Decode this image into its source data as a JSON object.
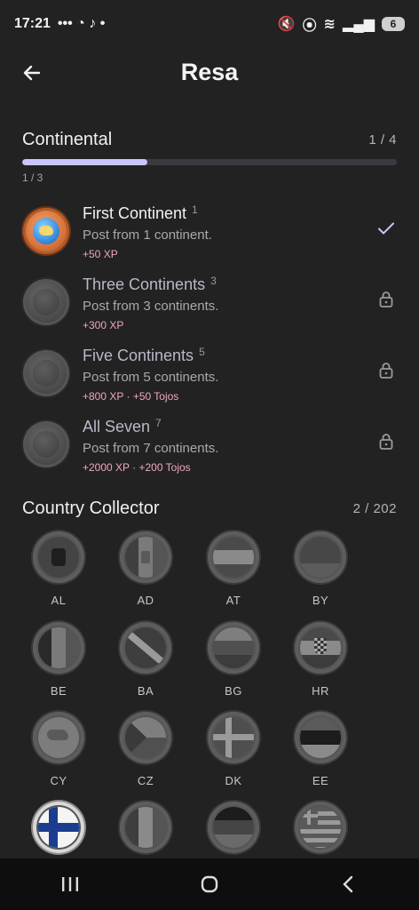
{
  "status_bar": {
    "time": "17:21",
    "battery": "6"
  },
  "app_bar": {
    "title": "Resa"
  },
  "continental": {
    "title": "Continental",
    "count": "1 / 4",
    "progress_label": "1 / 3",
    "progress_fraction": 0.333,
    "achievements": [
      {
        "name": "First Continent",
        "level": "1",
        "desc": "Post from 1 continent.",
        "reward": "+50 XP",
        "status": "completed",
        "status_icon": "check-icon"
      },
      {
        "name": "Three Continents",
        "level": "3",
        "desc": "Post from 3 continents.",
        "reward": "+300 XP",
        "status": "locked",
        "status_icon": "lock-icon"
      },
      {
        "name": "Five Continents",
        "level": "5",
        "desc": "Post from 5 continents.",
        "reward": "+800 XP · +50 Tojos",
        "status": "locked",
        "status_icon": "lock-icon"
      },
      {
        "name": "All Seven",
        "level": "7",
        "desc": "Post from 7 continents.",
        "reward": "+2000 XP · +200 Tojos",
        "status": "locked",
        "status_icon": "lock-icon"
      }
    ]
  },
  "country_collector": {
    "title": "Country Collector",
    "count": "2 / 202",
    "countries": [
      {
        "code": "AL",
        "unlocked": false
      },
      {
        "code": "AD",
        "unlocked": false
      },
      {
        "code": "AT",
        "unlocked": false
      },
      {
        "code": "BY",
        "unlocked": false
      },
      {
        "code": "BE",
        "unlocked": false
      },
      {
        "code": "BA",
        "unlocked": false
      },
      {
        "code": "BG",
        "unlocked": false
      },
      {
        "code": "HR",
        "unlocked": false
      },
      {
        "code": "CY",
        "unlocked": false
      },
      {
        "code": "CZ",
        "unlocked": false
      },
      {
        "code": "DK",
        "unlocked": false
      },
      {
        "code": "EE",
        "unlocked": false
      },
      {
        "code": "FI",
        "unlocked": true
      },
      {
        "code": "FR",
        "unlocked": false
      },
      {
        "code": "DE",
        "unlocked": false
      },
      {
        "code": "GR",
        "unlocked": false
      }
    ]
  },
  "colors": {
    "accent": "#c9c5ff",
    "reward": "#f0a7bd",
    "background": "#222222"
  }
}
